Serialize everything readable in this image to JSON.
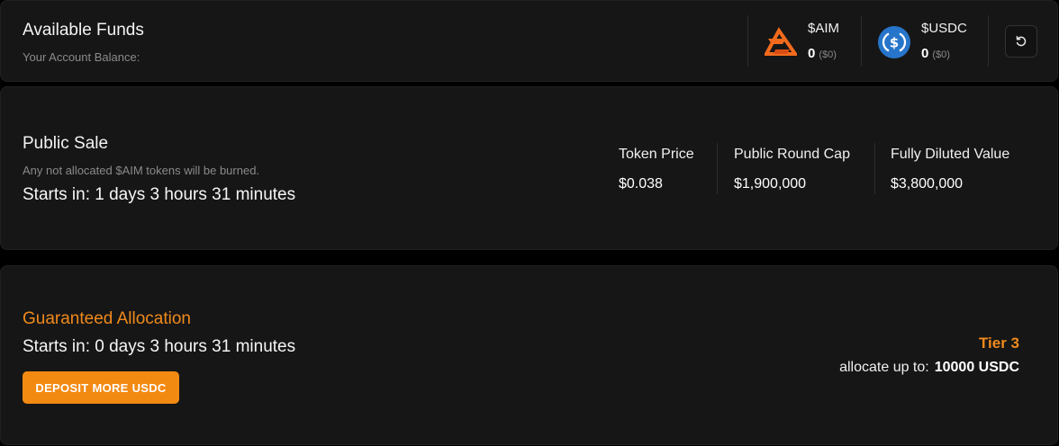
{
  "funds": {
    "title": "Available Funds",
    "subtitle": "Your Account Balance:",
    "tokens": [
      {
        "name": "$AIM",
        "balance": "0",
        "usd": "($0)",
        "icon": "aim-logo-icon"
      },
      {
        "name": "$USDC",
        "balance": "0",
        "usd": "($0)",
        "icon": "usdc-logo-icon"
      }
    ],
    "refresh_icon": "refresh-icon"
  },
  "public_sale": {
    "title": "Public Sale",
    "subtitle": "Any not allocated $AIM tokens will be burned.",
    "countdown": "Starts in: 1 days 3 hours 31 minutes",
    "stats": [
      {
        "label": "Token Price",
        "value": "$0.038"
      },
      {
        "label": "Public Round Cap",
        "value": "$1,900,000"
      },
      {
        "label": "Fully Diluted Value",
        "value": "$3,800,000"
      }
    ]
  },
  "guaranteed": {
    "title": "Guaranteed Allocation",
    "countdown": "Starts in: 0 days 3 hours 31 minutes",
    "deposit_label": "DEPOSIT MORE USDC",
    "tier": "Tier 3",
    "allocate_prefix": "allocate up to:",
    "allocate_amount": "10000 USDC"
  },
  "colors": {
    "accent": "#f08a1c",
    "button": "#f28a12",
    "card": "#161616",
    "usdc": "#2775ca"
  }
}
